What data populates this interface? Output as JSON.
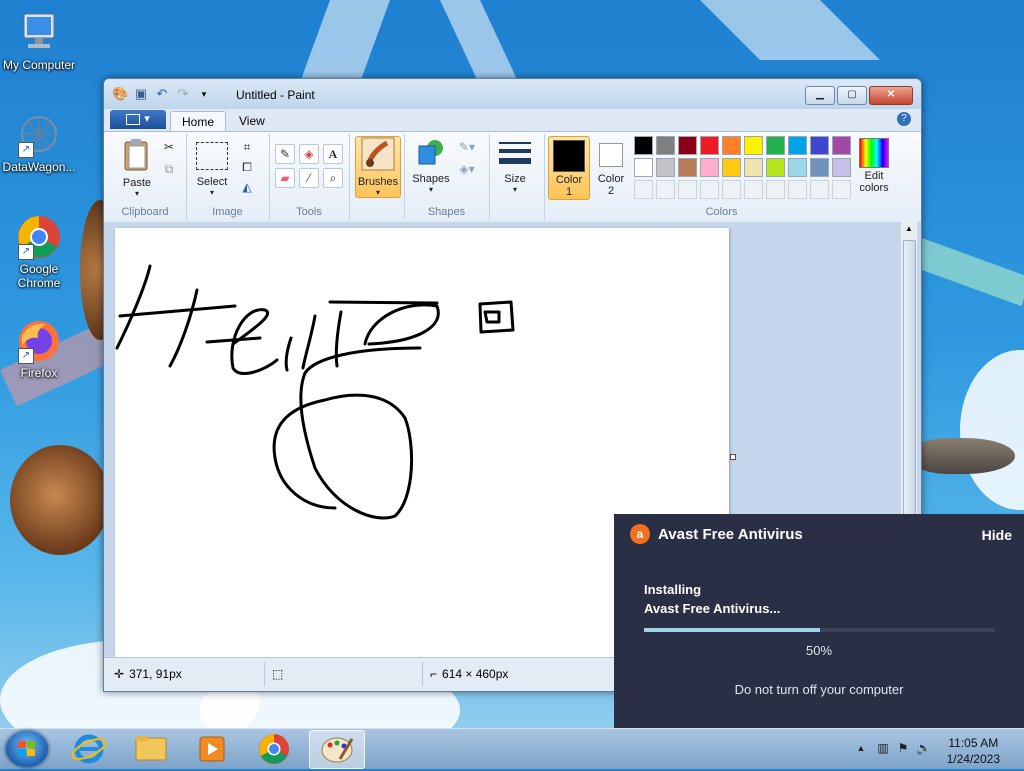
{
  "desktop": {
    "icons": [
      {
        "label": "My Computer"
      },
      {
        "label": "DataWagon..."
      },
      {
        "label": "Google Chrome"
      },
      {
        "label": "Firefox"
      }
    ]
  },
  "paint": {
    "title": "Untitled - Paint",
    "tabs": [
      {
        "label": "Home"
      },
      {
        "label": "View"
      }
    ],
    "file_button": "▾",
    "ribbon": {
      "clipboard": {
        "group_label": "Clipboard",
        "paste_label": "Paste"
      },
      "image": {
        "group_label": "Image",
        "select_label": "Select"
      },
      "tools": {
        "group_label": "Tools"
      },
      "brushes": {
        "label": "Brushes"
      },
      "shapes": {
        "group_label": "Shapes",
        "label": "Shapes"
      },
      "size": {
        "label": "Size"
      },
      "colors": {
        "group_label": "Colors",
        "color1_label": "Color",
        "color1_num": "1",
        "color2_label": "Color",
        "color2_num": "2",
        "edit_label": "Edit",
        "edit_label2": "colors",
        "color1": "#000000",
        "color2": "#ffffff",
        "palette_row1": [
          "#000000",
          "#7f7f7f",
          "#880015",
          "#ed1c24",
          "#ff7f27",
          "#fff200",
          "#22b14c",
          "#00a2e8",
          "#3f48cc",
          "#a349a4"
        ],
        "palette_row2": [
          "#ffffff",
          "#c3c3c3",
          "#b97a57",
          "#ffaec9",
          "#ffc90e",
          "#efe4b0",
          "#b5e61d",
          "#99d9ea",
          "#7092be",
          "#c8bfe7"
        ]
      }
    },
    "status": {
      "cursor_pos": "371, 91px",
      "canvas_size": "614 × 460px"
    }
  },
  "avast": {
    "title": "Avast Free Antivirus",
    "hide": "Hide",
    "line1": "Installing",
    "line2": "Avast Free Antivirus...",
    "progress": 0.5,
    "percent": "50%",
    "warning": "Do not turn off your computer"
  },
  "taskbar": {
    "time": "11:05 AM",
    "date": "1/24/2023"
  }
}
